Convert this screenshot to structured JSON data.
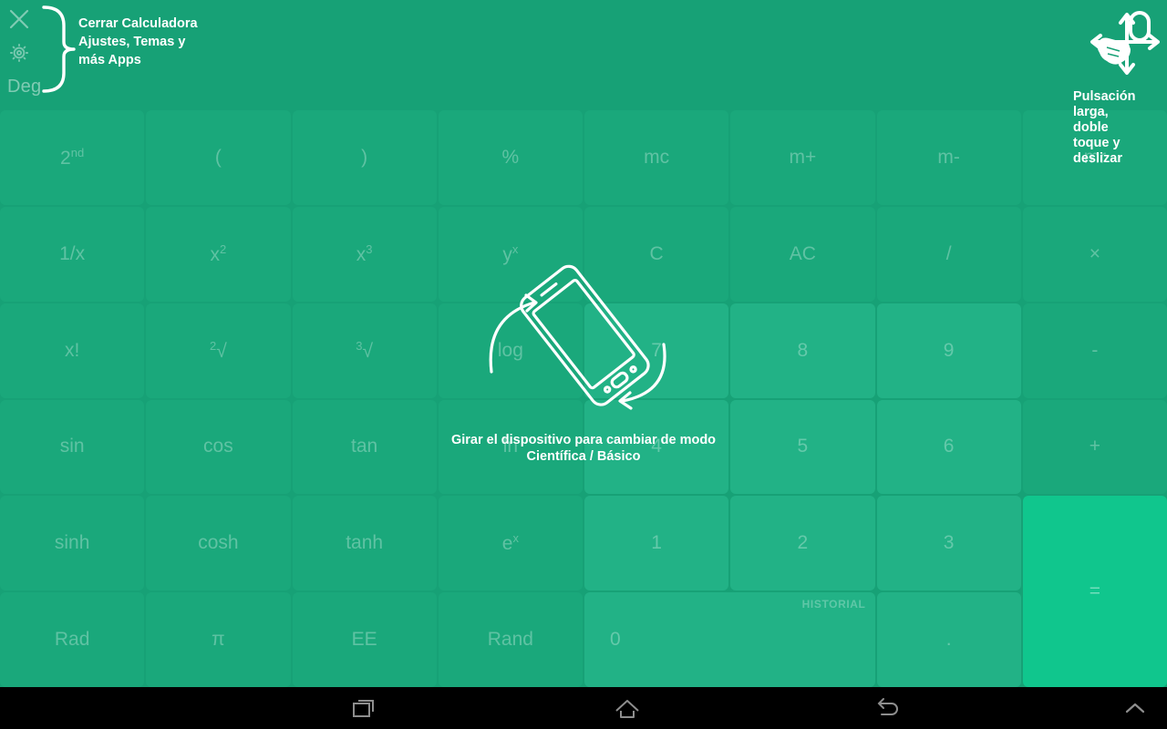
{
  "app": {
    "name": "Calculadora",
    "mode_indicator": "Deg",
    "background_color": "#17a176",
    "accent_color": "#10c68d",
    "key_color": "#1aa87b",
    "number_key_color": "#22b286"
  },
  "status": {
    "close_icon": "close-icon",
    "settings_icon": "gear-icon",
    "angle_unit": "Deg"
  },
  "coachmarks": {
    "top_left": {
      "text": "Cerrar Calculadora\nAjustes, Temas y\nmás Apps",
      "line1": "Cerrar Calculadora",
      "line2": "Ajustes, Temas y",
      "line3": "más Apps",
      "brace_icon": "curly-brace-icon"
    },
    "top_right": {
      "line1": "Pulsación",
      "line2": "larga,",
      "line3": "doble",
      "line4": "toque y",
      "line5": "deslizar",
      "gesture_icon": "hand-gesture-icon"
    },
    "center": {
      "line1": "Girar el dispositivo para cambiar de modo",
      "line2": "Científica / Básico",
      "phone_icon": "rotate-device-icon"
    }
  },
  "keypad": {
    "history_label": "HISTORIAL",
    "rows": [
      [
        {
          "label": "2",
          "sup": "nd",
          "name": "second",
          "type": "fn"
        },
        {
          "label": "(",
          "name": "open-paren",
          "type": "fn"
        },
        {
          "label": ")",
          "name": "close-paren",
          "type": "fn"
        },
        {
          "label": "%",
          "name": "percent",
          "type": "fn"
        },
        {
          "label": "mc",
          "name": "memory-clear",
          "type": "fn"
        },
        {
          "label": "m+",
          "name": "memory-add",
          "type": "fn"
        },
        {
          "label": "m-",
          "name": "memory-subtract",
          "type": "fn"
        },
        {
          "label": "mr",
          "name": "memory-recall",
          "type": "fn"
        }
      ],
      [
        {
          "label": "1/x",
          "name": "reciprocal",
          "type": "fn"
        },
        {
          "label": "x",
          "sup": "2",
          "name": "square",
          "type": "fn"
        },
        {
          "label": "x",
          "sup": "3",
          "name": "cube",
          "type": "fn"
        },
        {
          "label": "y",
          "sup": "x",
          "name": "power",
          "type": "fn"
        },
        {
          "label": "C",
          "name": "clear",
          "type": "fn"
        },
        {
          "label": "AC",
          "name": "all-clear",
          "type": "fn"
        },
        {
          "label": "/",
          "name": "divide",
          "type": "op"
        },
        {
          "label": "×",
          "name": "multiply",
          "type": "op"
        }
      ],
      [
        {
          "label": "x!",
          "name": "factorial",
          "type": "fn"
        },
        {
          "pre": "2",
          "label": "√",
          "name": "square-root",
          "type": "fn"
        },
        {
          "pre": "3",
          "label": "√",
          "name": "cube-root",
          "type": "fn"
        },
        {
          "label": "log",
          "name": "log",
          "type": "fn"
        },
        {
          "label": "7",
          "name": "digit-7",
          "type": "num"
        },
        {
          "label": "8",
          "name": "digit-8",
          "type": "num"
        },
        {
          "label": "9",
          "name": "digit-9",
          "type": "num"
        },
        {
          "label": "-",
          "name": "subtract",
          "type": "op"
        }
      ],
      [
        {
          "label": "sin",
          "name": "sin",
          "type": "fn"
        },
        {
          "label": "cos",
          "name": "cos",
          "type": "fn"
        },
        {
          "label": "tan",
          "name": "tan",
          "type": "fn"
        },
        {
          "label": "ln",
          "name": "ln",
          "type": "fn"
        },
        {
          "label": "4",
          "name": "digit-4",
          "type": "num"
        },
        {
          "label": "5",
          "name": "digit-5",
          "type": "num"
        },
        {
          "label": "6",
          "name": "digit-6",
          "type": "num"
        },
        {
          "label": "+",
          "name": "add",
          "type": "op"
        }
      ],
      [
        {
          "label": "sinh",
          "name": "sinh",
          "type": "fn"
        },
        {
          "label": "cosh",
          "name": "cosh",
          "type": "fn"
        },
        {
          "label": "tanh",
          "name": "tanh",
          "type": "fn"
        },
        {
          "label": "e",
          "sup": "x",
          "name": "exp",
          "type": "fn"
        },
        {
          "label": "1",
          "name": "digit-1",
          "type": "num"
        },
        {
          "label": "2",
          "name": "digit-2",
          "type": "num"
        },
        {
          "label": "3",
          "name": "digit-3",
          "type": "num"
        },
        {
          "label": "=",
          "name": "equals",
          "type": "equals",
          "span_rows": 2
        }
      ],
      [
        {
          "label": "Rad",
          "name": "rad",
          "type": "fn"
        },
        {
          "label": "π",
          "name": "pi",
          "type": "fn"
        },
        {
          "label": "EE",
          "name": "ee",
          "type": "fn"
        },
        {
          "label": "Rand",
          "name": "rand",
          "type": "fn"
        },
        {
          "label": "0",
          "name": "digit-0",
          "type": "num",
          "span_cols": 2
        },
        {
          "label": ".",
          "name": "decimal-point",
          "type": "num"
        }
      ]
    ]
  },
  "nav_bar": {
    "recents_icon": "recents-icon",
    "home_icon": "home-icon",
    "back_icon": "back-icon",
    "expand_icon": "chevron-up-icon"
  }
}
